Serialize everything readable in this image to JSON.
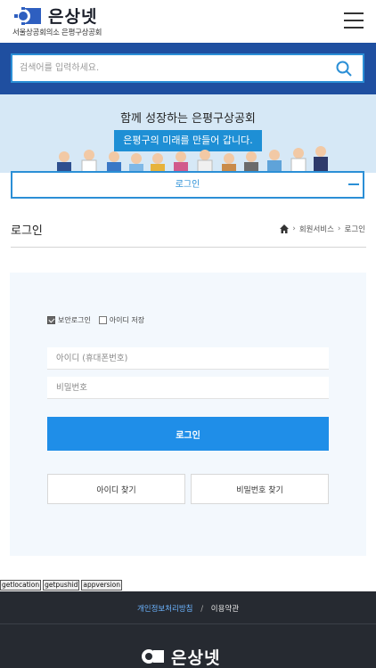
{
  "header": {
    "brand_name": "은상넷",
    "brand_sub": "서울상공회의소 은평구상공회",
    "logo_icon": "gear-logo-icon",
    "menu_icon": "hamburger-menu-icon"
  },
  "search": {
    "placeholder": "검색어를 입력하세요.",
    "value": "",
    "icon": "search-icon"
  },
  "banner": {
    "title": "함께 성장하는 은평구상공회",
    "tagline": "은평구의 미래를 만들어 갑니다."
  },
  "login_bar": {
    "label": "로그인"
  },
  "page": {
    "title": "로그인",
    "breadcrumb": [
      "회원서비스",
      "로그인"
    ]
  },
  "login_form": {
    "secure_login_label": "보안로그인",
    "secure_login_checked": true,
    "save_id_label": "아이디 저장",
    "save_id_checked": false,
    "id_placeholder": "아이디 (휴대폰번호)",
    "pw_placeholder": "비밀번호",
    "submit_label": "로그인",
    "find_id_label": "아이디 찾기",
    "find_pw_label": "비밀번호 찾기"
  },
  "debug_buttons": [
    "getlocation",
    "getpushid",
    "appversion"
  ],
  "footer": {
    "privacy_label": "개인정보처리방침",
    "separator": "/",
    "terms_label": "이용약관",
    "brand_name": "은상넷"
  },
  "colors": {
    "navy": "#1f4fa0",
    "accent": "#1f8ee8",
    "banner_bg": "#d6e8f6",
    "footer_bg": "#262a31"
  }
}
